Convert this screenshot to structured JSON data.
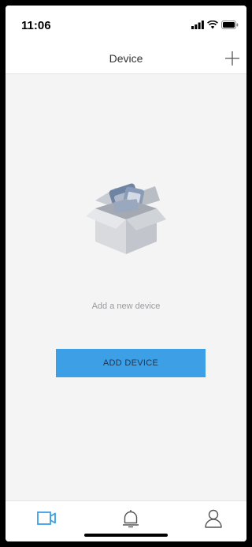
{
  "status_bar": {
    "time": "11:06"
  },
  "header": {
    "title": "Device",
    "add_icon": "plus-icon"
  },
  "empty_state": {
    "illustration": "open-box-icon",
    "message": "Add a new device",
    "button_label": "ADD DEVICE"
  },
  "tab_bar": {
    "items": [
      {
        "icon": "video-camera-icon",
        "active": true
      },
      {
        "icon": "bell-icon",
        "active": false
      },
      {
        "icon": "person-icon",
        "active": false
      }
    ]
  },
  "colors": {
    "accent": "#3d9fe5",
    "background": "#f4f4f5",
    "text_muted": "#9a9a9e"
  }
}
